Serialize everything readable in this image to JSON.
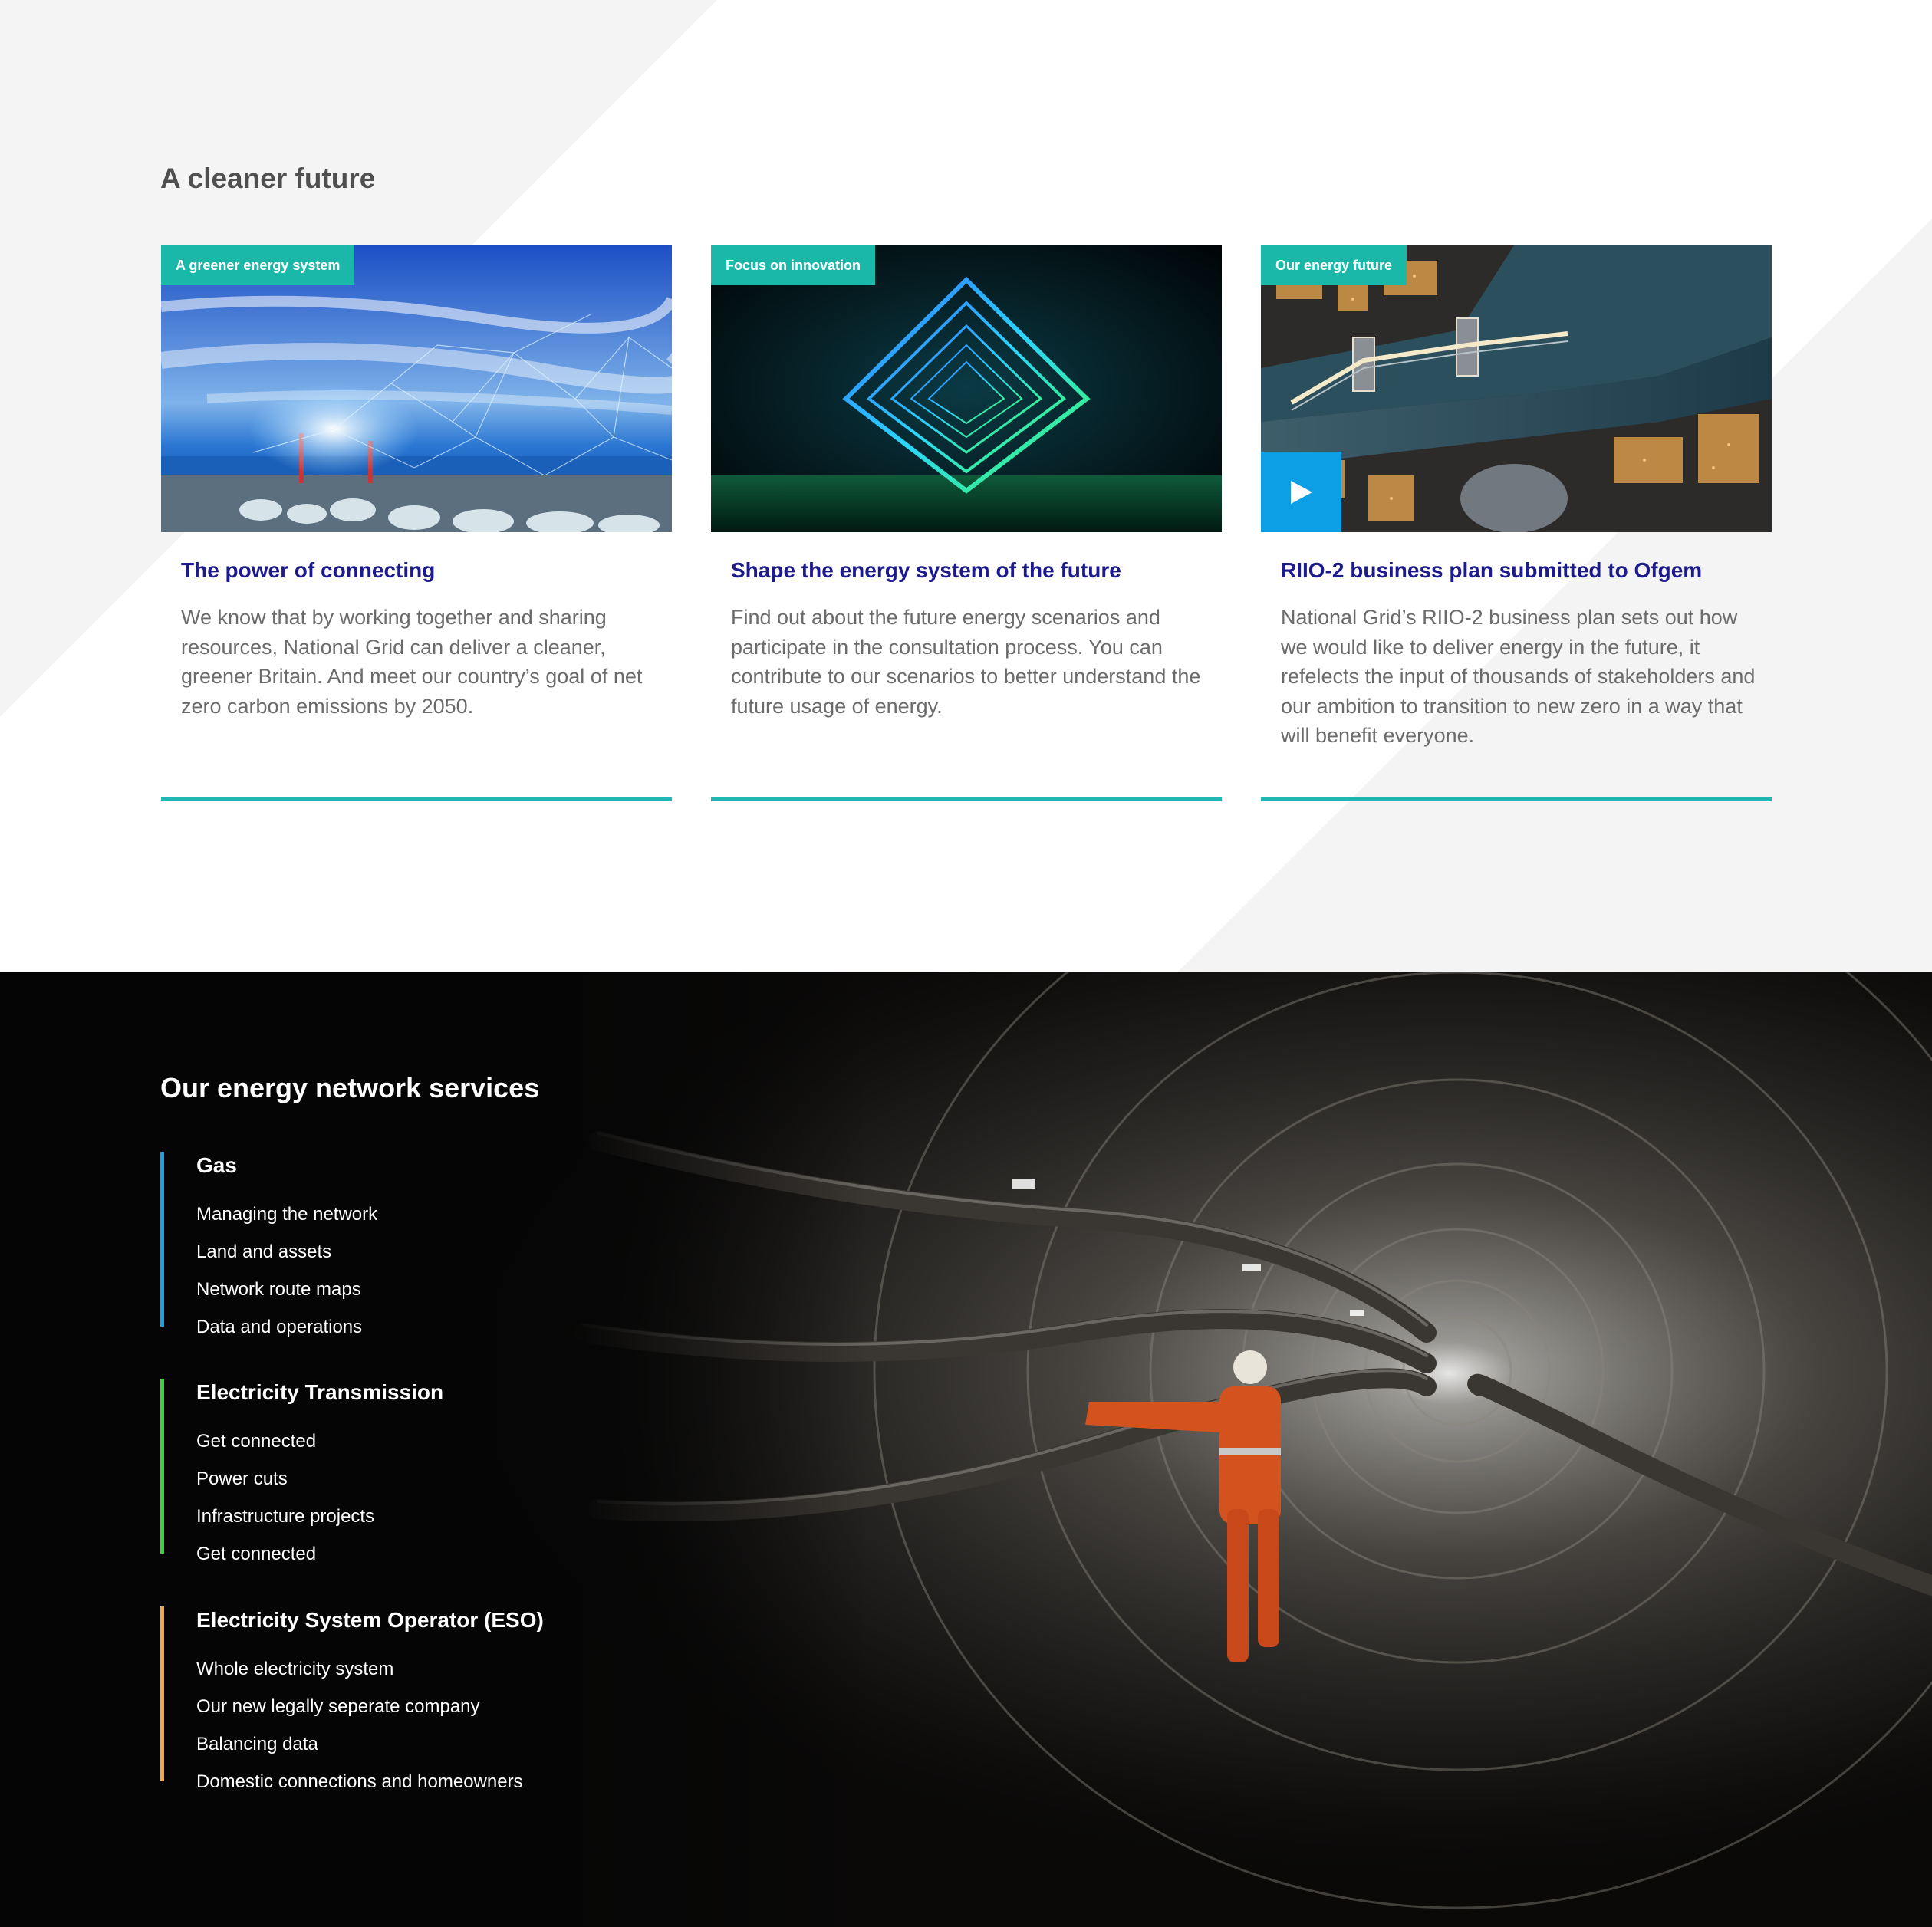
{
  "cleaner_future": {
    "title": "A cleaner future",
    "cards": [
      {
        "tag": "A greener energy system",
        "title": "The power of connecting",
        "description": "We know that by working together and sharing resources, National Grid can deliver a cleaner, greener Britain. And meet our country’s goal of net zero carbon emissions by 2050."
      },
      {
        "tag": "Focus on innovation",
        "title": "Shape the energy system of the future",
        "description": "Find out about the future energy scenarios and participate in the consultation process. You can contribute to our scenarios to better understand the future usage of energy."
      },
      {
        "tag": "Our energy future",
        "title": "RIIO-2 business plan submitted to Ofgem",
        "description": "National Grid’s RIIO-2 business plan sets out how we would like to deliver energy in the future, it refelects the input of thousands of stakeholders and our ambition to transition to new zero in a way that will benefit everyone.",
        "has_play_button": true
      }
    ]
  },
  "network_services": {
    "title": "Our energy network services",
    "groups": [
      {
        "title": "Gas",
        "accent": "#1a9fe0",
        "links": [
          "Managing the network",
          "Land and assets",
          "Network route maps",
          "Data and operations"
        ]
      },
      {
        "title": "Electricity Transmission",
        "accent": "#3fd13f",
        "links": [
          "Get connected",
          "Power cuts",
          "Infrastructure projects",
          "Get connected"
        ]
      },
      {
        "title": "Electricity System Operator (ESO)",
        "accent": "#f2a64a",
        "links": [
          "Whole electricity system",
          "Our new legally seperate company",
          "Balancing data",
          "Domestic connections and homeowners"
        ]
      }
    ]
  },
  "colors": {
    "tag_bg": "#1ab8a8",
    "card_title": "#1c1a8c",
    "card_rule": "#1fb7b4",
    "play_button": "#0d9fe6",
    "bottom_bg": "#050505"
  },
  "icons": {
    "play": "play-icon"
  }
}
